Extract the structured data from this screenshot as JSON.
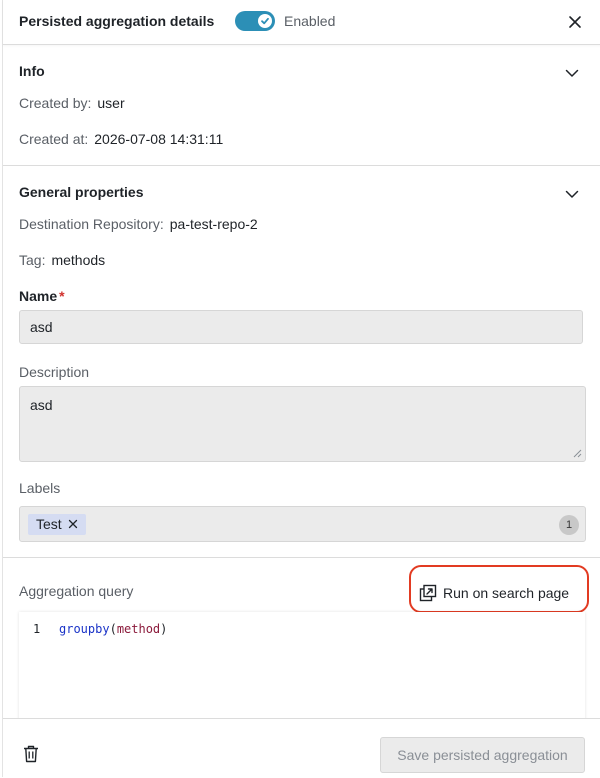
{
  "header": {
    "title": "Persisted aggregation details",
    "toggle_label": "Enabled",
    "toggle_on": true
  },
  "info": {
    "title": "Info",
    "created_by_label": "Created by:",
    "created_by_value": "user",
    "created_at_label": "Created at:",
    "created_at_value": "2026-07-08 14:31:11"
  },
  "general": {
    "title": "General properties",
    "dest_label": "Destination Repository:",
    "dest_value": "pa-test-repo-2",
    "tag_label": "Tag:",
    "tag_value": "methods",
    "name_label": "Name",
    "name_required": "*",
    "name_value": "asd",
    "description_label": "Description",
    "description_value": "asd",
    "labels_label": "Labels",
    "labels": [
      "Test"
    ],
    "labels_count": "1"
  },
  "query": {
    "label": "Aggregation query",
    "run_label": "Run on search page",
    "line_number": "1",
    "code_fn": "groupby",
    "code_open": "(",
    "code_arg": "method",
    "code_close": ")"
  },
  "footer": {
    "save_label": "Save persisted aggregation"
  },
  "colors": {
    "accent": "#2c8fb6",
    "highlight": "#e23b22",
    "required": "#d0312d",
    "chip": "#d5dcf2"
  }
}
